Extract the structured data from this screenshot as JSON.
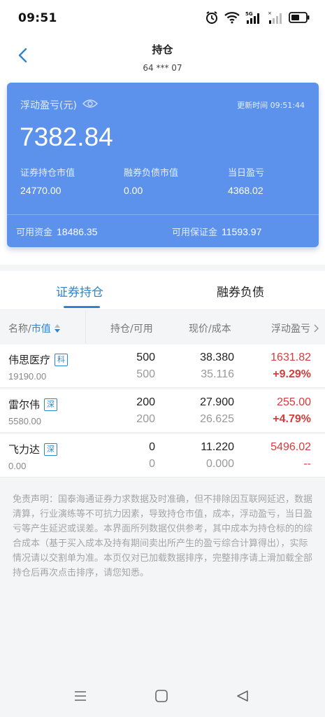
{
  "status_bar": {
    "time": "09:51"
  },
  "header": {
    "title": "持仓",
    "subtitle": "64 *** 07"
  },
  "summary": {
    "pl_label": "浮动盈亏(元)",
    "update_label": "更新时间 09:51:44",
    "pl_value": "7382.84",
    "stats": [
      {
        "label": "证券持仓市值",
        "value": "24770.00"
      },
      {
        "label": "融券负债市值",
        "value": "0.00"
      },
      {
        "label": "当日盈亏",
        "value": "4368.02"
      }
    ],
    "available_funds_label": "可用资金",
    "available_funds_value": "18486.35",
    "available_margin_label": "可用保证金",
    "available_margin_value": "11593.97"
  },
  "tabs": {
    "holdings": "证券持仓",
    "short_debt": "融券负债"
  },
  "table": {
    "headers": {
      "name_prefix": "名称/",
      "name_sort": "市值",
      "qty": "持仓/可用",
      "price": "现价/成本",
      "pl": "浮动盈亏"
    },
    "rows": [
      {
        "name": "伟思医疗",
        "badge": "科",
        "market_value": "19190.00",
        "qty": "500",
        "avail": "500",
        "price": "38.380",
        "cost": "35.116",
        "pl": "1631.82",
        "pl_pct": "+9.29%"
      },
      {
        "name": "雷尔伟",
        "badge": "深",
        "market_value": "5580.00",
        "qty": "200",
        "avail": "200",
        "price": "27.900",
        "cost": "26.625",
        "pl": "255.00",
        "pl_pct": "+4.79%"
      },
      {
        "name": "飞力达",
        "badge": "深",
        "market_value": "0.00",
        "qty": "0",
        "avail": "0",
        "price": "11.220",
        "cost": "0.000",
        "pl": "5496.02",
        "pl_pct": "--"
      }
    ]
  },
  "disclaimer": "免责声明：国泰海通证券力求数据及时准确，但不排除因互联网延迟，数据清算，行业演练等不可抗力因素，导致持仓市值，成本，浮动盈亏，当日盈亏等产生延迟或误差。本界面所列数据仅供参考，其中成本为持仓标的的综合成本（基于买入成本及持有期间卖出所产生的盈亏综合计算得出），实际情况请以交割单为准。本页仅对已加载数据排序，完整排序请上滑加载全部持仓后再次点击排序，请您知悉。",
  "colors": {
    "accent": "#2e84d0",
    "card": "#5c92ec",
    "profit": "#d33d3d"
  },
  "icons": [
    "alarm-icon",
    "wifi-icon",
    "signal-5g-icon",
    "signal-icon",
    "battery-icon",
    "back-arrow-icon",
    "eye-icon",
    "sort-icon",
    "chevron-right-icon",
    "menu-nav-icon",
    "home-nav-icon",
    "back-nav-icon"
  ]
}
